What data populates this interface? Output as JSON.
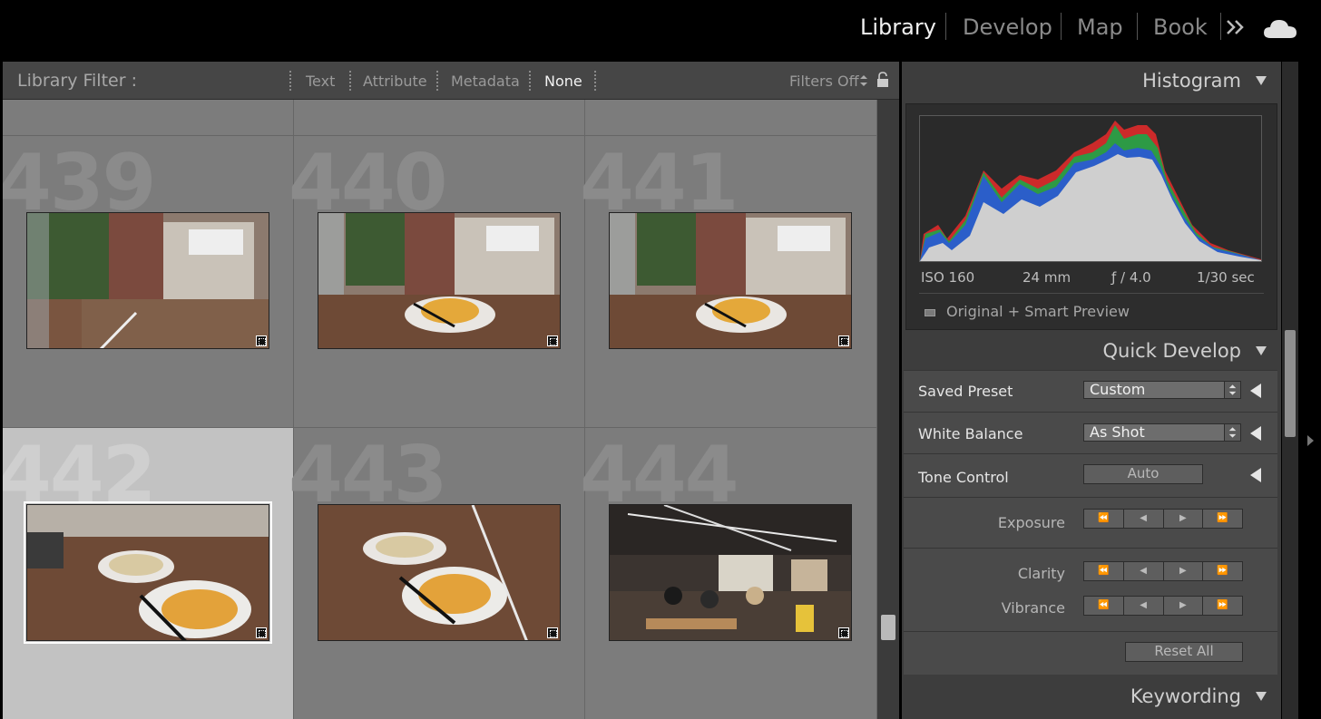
{
  "modules": {
    "library": "Library",
    "develop": "Develop",
    "map": "Map",
    "book": "Book",
    "more_icon": "double-chevron-right-icon",
    "cloud_icon": "cloud-icon"
  },
  "filter_bar": {
    "title": "Library Filter :",
    "tabs": [
      "Text",
      "Attribute",
      "Metadata",
      "None"
    ],
    "active_tab": "None",
    "filters_state": "Filters Off",
    "lock_icon": "lock-icon"
  },
  "grid": {
    "cells": [
      {
        "index": "439",
        "scene": "street"
      },
      {
        "index": "440",
        "scene": "omelette"
      },
      {
        "index": "441",
        "scene": "omelette"
      },
      {
        "index": "442",
        "scene": "dumplings",
        "selected": true
      },
      {
        "index": "443",
        "scene": "dumplings"
      },
      {
        "index": "444",
        "scene": "restaurant"
      }
    ]
  },
  "histogram": {
    "title": "Histogram",
    "iso": "ISO 160",
    "focal": "24 mm",
    "aperture": "ƒ / 4.0",
    "shutter": "1/30 sec",
    "preview_label": "Original + Smart Preview"
  },
  "quick_develop": {
    "title": "Quick Develop",
    "saved_preset_label": "Saved Preset",
    "saved_preset_value": "Custom",
    "white_balance_label": "White Balance",
    "white_balance_value": "As Shot",
    "tone_control_label": "Tone Control",
    "auto_label": "Auto",
    "exposure_label": "Exposure",
    "clarity_label": "Clarity",
    "vibrance_label": "Vibrance",
    "reset_label": "Reset All",
    "step_icons": [
      "⏪",
      "◀",
      "▶",
      "⏩"
    ]
  },
  "keywording": {
    "title": "Keywording"
  },
  "colors": {
    "background": "#7c7c7c",
    "selected_cell": "#c2c2c2",
    "panel": "#3d3d3d"
  }
}
